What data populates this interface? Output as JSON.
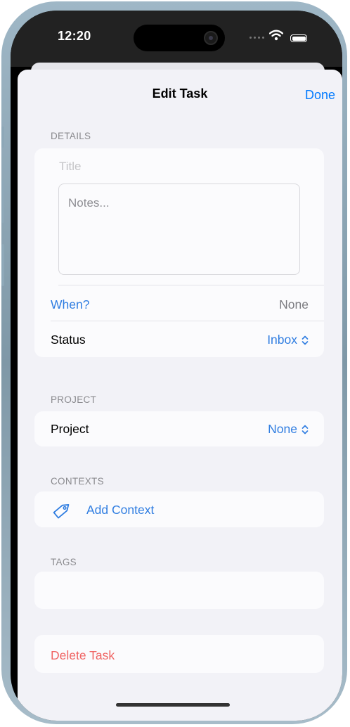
{
  "status_bar": {
    "time": "12:20"
  },
  "nav": {
    "title": "Edit Task",
    "done_label": "Done"
  },
  "details": {
    "header": "DETAILS",
    "title_placeholder": "Title",
    "notes_placeholder": "Notes...",
    "when_label": "When?",
    "when_value": "None",
    "status_label": "Status",
    "status_value": "Inbox"
  },
  "project": {
    "header": "PROJECT",
    "label": "Project",
    "value": "None"
  },
  "contexts": {
    "header": "CONTEXTS",
    "add_label": "Add Context",
    "icon": "tag-icon"
  },
  "tags": {
    "header": "TAGS"
  },
  "delete": {
    "label": "Delete Task"
  },
  "colors": {
    "accent": "#2f7de1",
    "destructive": "#f06463",
    "background": "#f2f2f7",
    "card": "#fbfbfd",
    "secondary_text": "#8a8a8e"
  }
}
